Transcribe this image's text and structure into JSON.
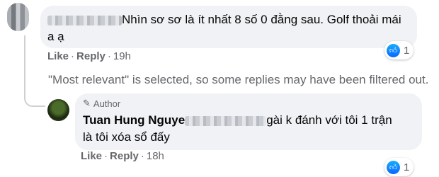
{
  "comment1": {
    "text_line1": "Nhìn sơ sơ là ít nhất 8 số 0 đằng sau. Golf thoải mái",
    "text_line2": "a ạ",
    "actions": {
      "like": "Like",
      "reply": "Reply",
      "time": "19h"
    },
    "reaction_count": "1"
  },
  "notice": "\"Most relevant\" is selected, so some replies may have been filtered out.",
  "reply": {
    "badge": "Author",
    "name": "Tuan Hung Nguye",
    "text_line1": "gài k đánh với tôi 1 trận",
    "text_line2": "là tôi xóa sổ đấy",
    "actions": {
      "like": "Like",
      "reply": "Reply",
      "time": "18h"
    },
    "reaction_count": "1"
  },
  "colors": {
    "bubble": "#f0f2f5",
    "meta": "#65676b",
    "like_blue": "#0866ff"
  },
  "icons": {
    "reaction": "thumbs-up-icon",
    "badge": "pencil-icon"
  }
}
